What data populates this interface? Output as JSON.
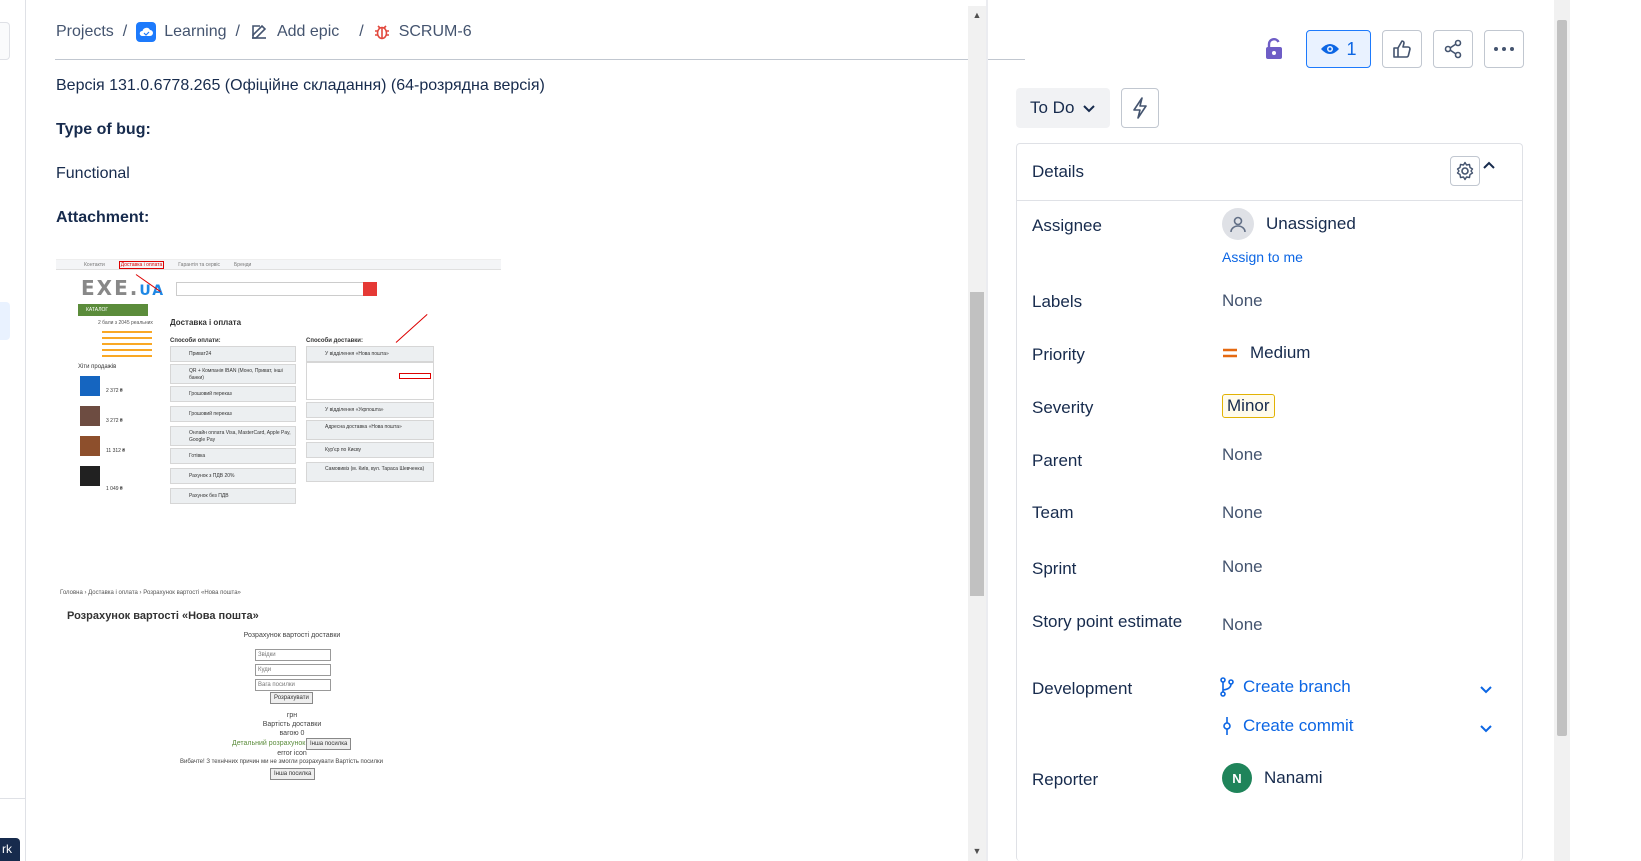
{
  "breadcrumb": {
    "projects": "Projects",
    "project": "Learning",
    "add_epic": "Add epic",
    "issue_key": "SCRUM-6",
    "sep": "/"
  },
  "description": {
    "version": "Версія 131.0.6778.265 (Офіційне складання) (64-розрядна версія)",
    "type_heading": "Type of bug:",
    "type_value": "Functional",
    "attachment_heading": "Attachment:"
  },
  "attachment1": {
    "topbar_items": [
      "Контакти",
      "Доставка і оплата",
      "Гарантія та сервіс",
      "Бренди"
    ],
    "logo_main": "EXE.",
    "logo_ua": "UA",
    "catalog": "КАТАЛОГ",
    "title": "Доставка і оплата",
    "pay_heading": "Способи оплати:",
    "delivery_heading": "Способи доставки:",
    "pay_rows": [
      "Приват24",
      "QR + Компанія IBAN (Моно, Приват, інші банки)",
      "Грошовий переказ",
      "Грошовий переказ",
      "Онлайн оплата Visa, MasterCard, Apple Pay, Google Pay",
      "Готівка",
      "Рахунок з ПДВ 20%",
      "Рахунок без ПДВ"
    ],
    "delivery_rows": [
      "У відділення «Нова пошта»",
      "У відділення «Укрпошта»",
      "Адресна доставка «Нова пошта»",
      "Кур'єр по Києву",
      "Самовивіз (м. Київ, вул. Тараса Шевченка)"
    ],
    "hits_heading": "Хіти продажів",
    "rating_text": "2 бали з 2045 реальних",
    "prices": [
      "2 372 ₴",
      "3 272 ₴",
      "11 312 ₴",
      "1 049 ₴"
    ]
  },
  "attachment2": {
    "crumbs": "Головна  ›  Доставка і оплата  ›  Розрахунок вартості «Нова пошта»",
    "heading": "Розрахунок вартості «Нова пошта»",
    "calc_label": "Розрахунок вартості доставки",
    "from_placeholder": "Звідки",
    "to_placeholder": "Куди",
    "weight_placeholder": "Вага посилки",
    "calc_button": "Розрахувати",
    "grn": "грн",
    "cost_label": "Вартість доставки",
    "cost_value": "вагою 0",
    "detail_link": "Детальний розрахунок",
    "other_parcel": "Інша посилка",
    "error_alt": "error icon",
    "error_text": "Вибачте! З технічних причин ми не змогли розрахувати Вартість посилки",
    "other_parcel_2": "Інша посилка"
  },
  "actions": {
    "watch_count": "1"
  },
  "status": {
    "label": "To Do"
  },
  "details": {
    "title": "Details",
    "assignee_label": "Assignee",
    "assignee_value": "Unassigned",
    "assign_to_me": "Assign to me",
    "labels_label": "Labels",
    "labels_value": "None",
    "priority_label": "Priority",
    "priority_value": "Medium",
    "severity_label": "Severity",
    "severity_value": "Minor",
    "parent_label": "Parent",
    "parent_value": "None",
    "team_label": "Team",
    "team_value": "None",
    "sprint_label": "Sprint",
    "sprint_value": "None",
    "story_points_label": "Story point estimate",
    "story_points_value": "None",
    "development_label": "Development",
    "create_branch": "Create branch",
    "create_commit": "Create commit",
    "reporter_label": "Reporter",
    "reporter_value": "Nanami",
    "reporter_initial": "N"
  },
  "left_strip": {
    "dark_tab": "rk"
  },
  "colors": {
    "link": "#0c66e4",
    "priority_medium": "#e56910",
    "severity_border": "#e2b203",
    "reporter_avatar": "#1f845a",
    "lock": "#6e5dc6"
  },
  "icons": [
    "project-icon",
    "edit-icon",
    "bug-icon",
    "lock-icon",
    "eye-icon",
    "thumbs-up-icon",
    "share-icon",
    "more-icon",
    "chevron-down-icon",
    "bolt-icon",
    "gear-icon",
    "chevron-up-icon",
    "user-icon",
    "priority-medium-icon",
    "branch-icon",
    "commit-icon"
  ]
}
